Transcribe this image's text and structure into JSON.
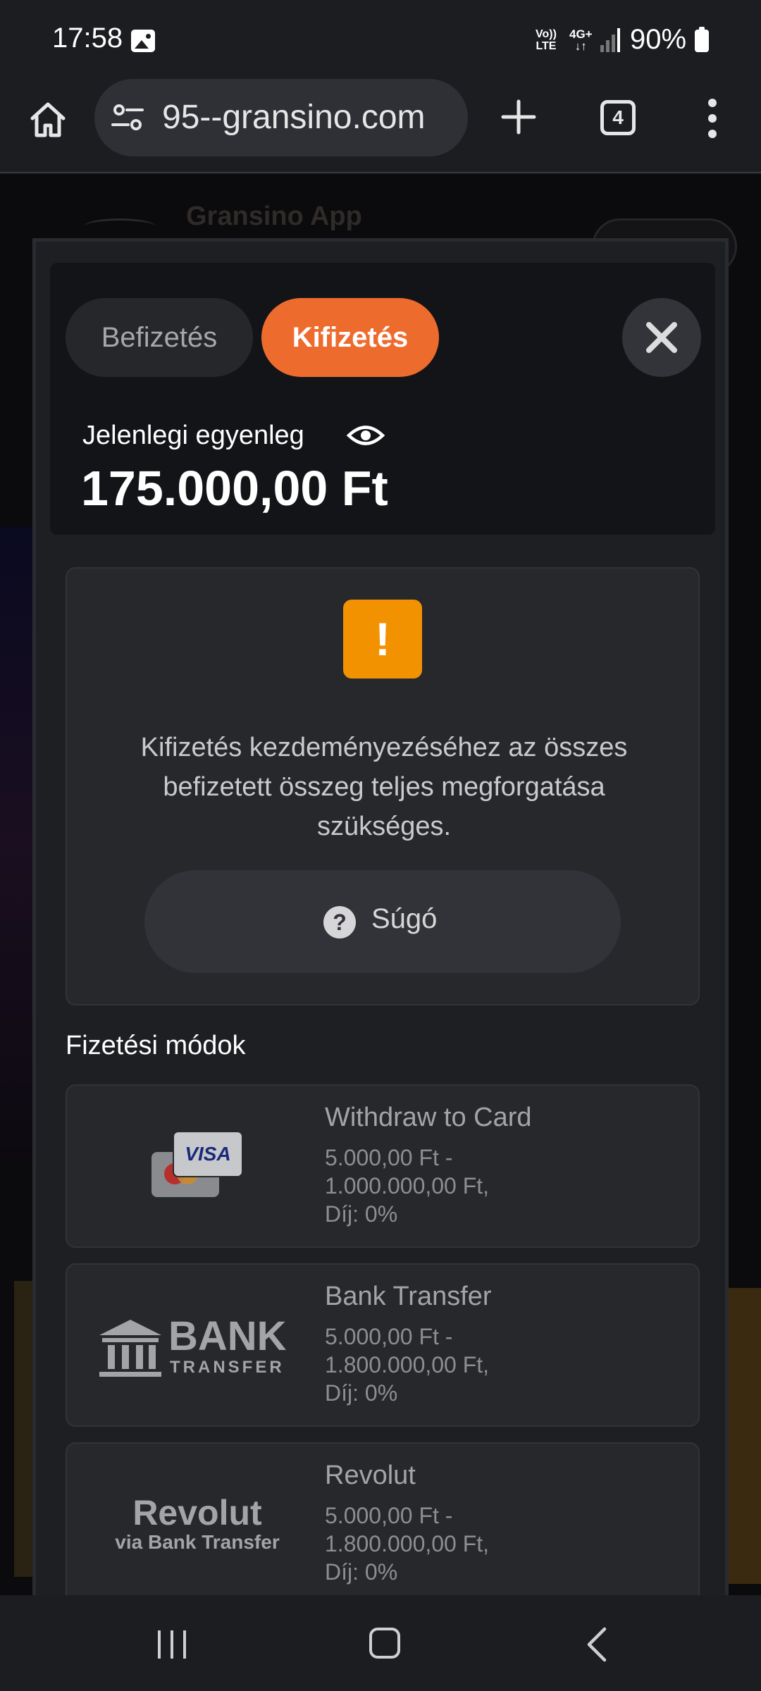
{
  "status_bar": {
    "time": "17:58",
    "network_volte_top": "Vo))",
    "network_volte_bottom": "LTE",
    "network_type": "4G+",
    "network_arrows": "↓↑",
    "battery": "90%"
  },
  "browser": {
    "url": "95--gransino.com",
    "tab_count": "4"
  },
  "background_page": {
    "title": "Gransino App"
  },
  "modal": {
    "tabs": [
      {
        "label": "Befizetés",
        "active": false
      },
      {
        "label": "Kifizetés",
        "active": true
      }
    ],
    "balance_label": "Jelenlegi egyenleg",
    "balance_value": "175.000,00 Ft",
    "notice": {
      "icon": "!",
      "text": "Kifizetés kezdeményezéséhez az összes befizetett összeg teljes megforgatása szükséges.",
      "help_icon": "?",
      "help_label": "Súgó"
    },
    "methods_title": "Fizetési módok",
    "methods": [
      {
        "name": "Withdraw to Card",
        "range_min": "5.000,00 Ft -",
        "range_max": "1.000.000,00 Ft,",
        "fee": "Díj: 0%",
        "logo_text": "VISA"
      },
      {
        "name": "Bank Transfer",
        "range_min": "5.000,00 Ft -",
        "range_max": "1.800.000,00 Ft,",
        "fee": "Díj: 0%",
        "logo_line1": "BANK",
        "logo_line2": "TRANSFER"
      },
      {
        "name": "Revolut",
        "range_min": "5.000,00 Ft -",
        "range_max": "1.800.000,00 Ft,",
        "fee": "Díj: 0%",
        "logo_line1": "Revolut",
        "logo_line2": "via Bank Transfer"
      }
    ]
  },
  "colors": {
    "accent": "#ee6b2e",
    "warning": "#f39200",
    "modal_bg": "#1e1f23",
    "card_bg": "#27282c"
  }
}
